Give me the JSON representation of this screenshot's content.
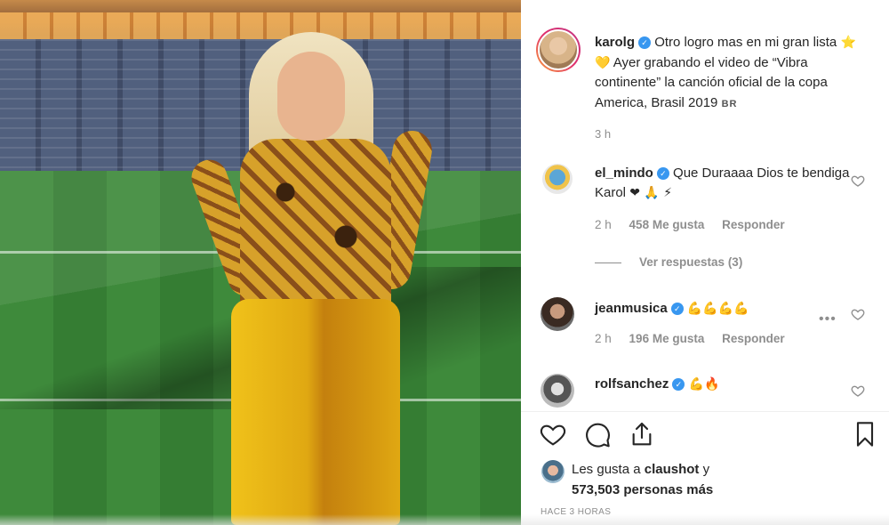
{
  "post": {
    "author": "karolg",
    "caption_text": "Otro logro mas en mi gran lista",
    "caption_emoji": "⭐ 💛",
    "caption_rest": "Ayer grabando el video de “Vibra continente” la canción oficial de la copa America, Brasil 2019",
    "caption_flag": "BR",
    "time": "3 h"
  },
  "comments": [
    {
      "user": "el_mindo",
      "text": "Que Duraaaa Dios te bendiga Karol",
      "emoji": "❤ 🙏 ⚡",
      "time": "2 h",
      "likes": "458 Me gusta",
      "reply": "Responder",
      "view_replies": "Ver respuestas (3)"
    },
    {
      "user": "jeanmusica",
      "text": "",
      "emoji": "💪💪💪💪",
      "time": "2 h",
      "likes": "196 Me gusta",
      "reply": "Responder",
      "more": "•••"
    },
    {
      "user": "rolfsanchez",
      "text": "",
      "emoji": "💪🔥"
    }
  ],
  "footer": {
    "likes_prefix": "Les gusta a",
    "likes_user": "claushot",
    "likes_y": "y",
    "likes_count": "573,503 personas más",
    "timestamp": "HACE 3 HORAS"
  },
  "icons": {
    "like": "heart-icon",
    "comment": "comment-icon",
    "share": "share-icon",
    "save": "bookmark-icon"
  },
  "colors": {
    "verified": "#3897f0",
    "heart_red": "#ed4956",
    "text": "#262626",
    "muted": "#8e8e8e"
  }
}
